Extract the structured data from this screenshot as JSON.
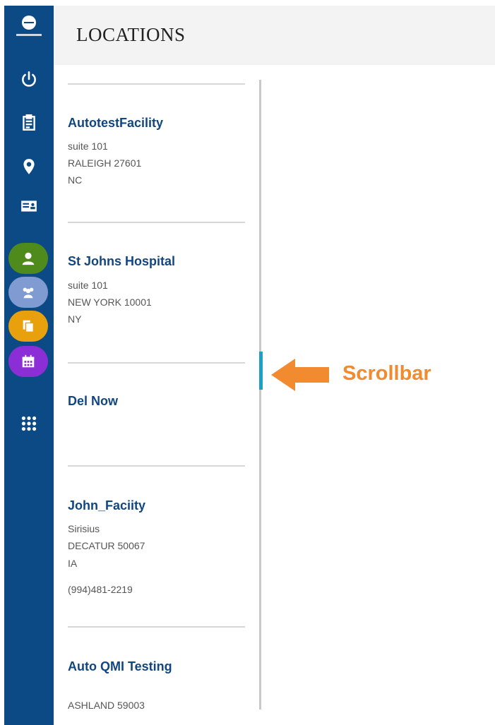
{
  "header": {
    "title": "LOCATIONS"
  },
  "sidebar": {
    "colors": {
      "background": "#0c4a86",
      "user": "#4f8a1c",
      "group": "#7f9bd1",
      "documents": "#e8a10c",
      "calendar": "#8c2ed6"
    },
    "nav": [
      "power-icon",
      "clipboard-icon",
      "map-pin-icon",
      "id-card-icon"
    ],
    "circles": [
      "user-icon",
      "group-icon",
      "documents-icon",
      "calendar-icon"
    ],
    "apps": "app-grid-icon"
  },
  "locations": [
    {
      "name": "AutotestFacility",
      "address": "suite 101",
      "city_zip": "RALEIGH  27601",
      "state": "NC"
    },
    {
      "name": "St Johns Hospital",
      "address": "suite 101",
      "city_zip": "NEW YORK  10001",
      "state": "NY"
    },
    {
      "name": "Del Now"
    },
    {
      "name": "John_Faciity",
      "address": "Sirisius",
      "city_zip": "DECATUR  50067",
      "state": "IA",
      "phone": "(994)481-2219"
    },
    {
      "name": "Auto QMI Testing",
      "city_zip": "ASHLAND  59003"
    }
  ],
  "annotation": {
    "label": "Scrollbar",
    "color": "#f28a2f"
  }
}
